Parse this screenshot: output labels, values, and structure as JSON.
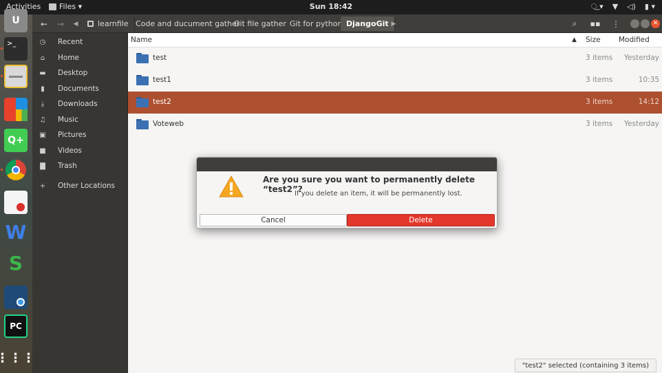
{
  "topbar": {
    "activities": "Activities",
    "app_menu": "Files ▾",
    "clock": "Sun 18:42",
    "tray": [
      "⵿ ▾",
      "▼",
      "◁)",
      "▮ ▾"
    ]
  },
  "dock": {
    "items": [
      "usb-drive",
      "terminal",
      "files",
      "software",
      "qt-creator",
      "chrome",
      "doc-viewer",
      "wps-writer",
      "wps-spreadsheet",
      "screenshot",
      "pycharm",
      "show-apps"
    ]
  },
  "headerbar": {
    "breadcrumbs": [
      "learnfile",
      "Code and ducument gather",
      "Git file gather",
      "Git for python",
      "DjangoGit"
    ],
    "active_index": 4
  },
  "sidebar": {
    "items": [
      {
        "label": "Recent",
        "icon": "clock-icon"
      },
      {
        "label": "Home",
        "icon": "home-icon"
      },
      {
        "label": "Desktop",
        "icon": "desktop-icon"
      },
      {
        "label": "Documents",
        "icon": "documents-icon"
      },
      {
        "label": "Downloads",
        "icon": "download-icon"
      },
      {
        "label": "Music",
        "icon": "music-icon"
      },
      {
        "label": "Pictures",
        "icon": "pictures-icon"
      },
      {
        "label": "Videos",
        "icon": "videos-icon"
      },
      {
        "label": "Trash",
        "icon": "trash-icon"
      }
    ],
    "other_locations": "Other Locations"
  },
  "columns": {
    "name": "Name",
    "size": "Size",
    "modified": "Modified"
  },
  "files": [
    {
      "name": "test",
      "size": "3 items",
      "modified": "Yesterday",
      "selected": false
    },
    {
      "name": "test1",
      "size": "3 items",
      "modified": "10:35",
      "selected": false
    },
    {
      "name": "test2",
      "size": "3 items",
      "modified": "14:12",
      "selected": true
    },
    {
      "name": "Voteweb",
      "size": "3 items",
      "modified": "Yesterday",
      "selected": false
    }
  ],
  "status": "\"test2\" selected  (containing 3 items)",
  "dialog": {
    "title": "Are you sure you want to permanently delete “test2”?",
    "message": "If you delete an item, it will be permanently lost.",
    "cancel_label": "Cancel",
    "delete_label": "Delete"
  },
  "colors": {
    "accent": "#e95420",
    "selection": "#ad5030",
    "delete": "#e2372a",
    "folder": "#3b70b3"
  }
}
